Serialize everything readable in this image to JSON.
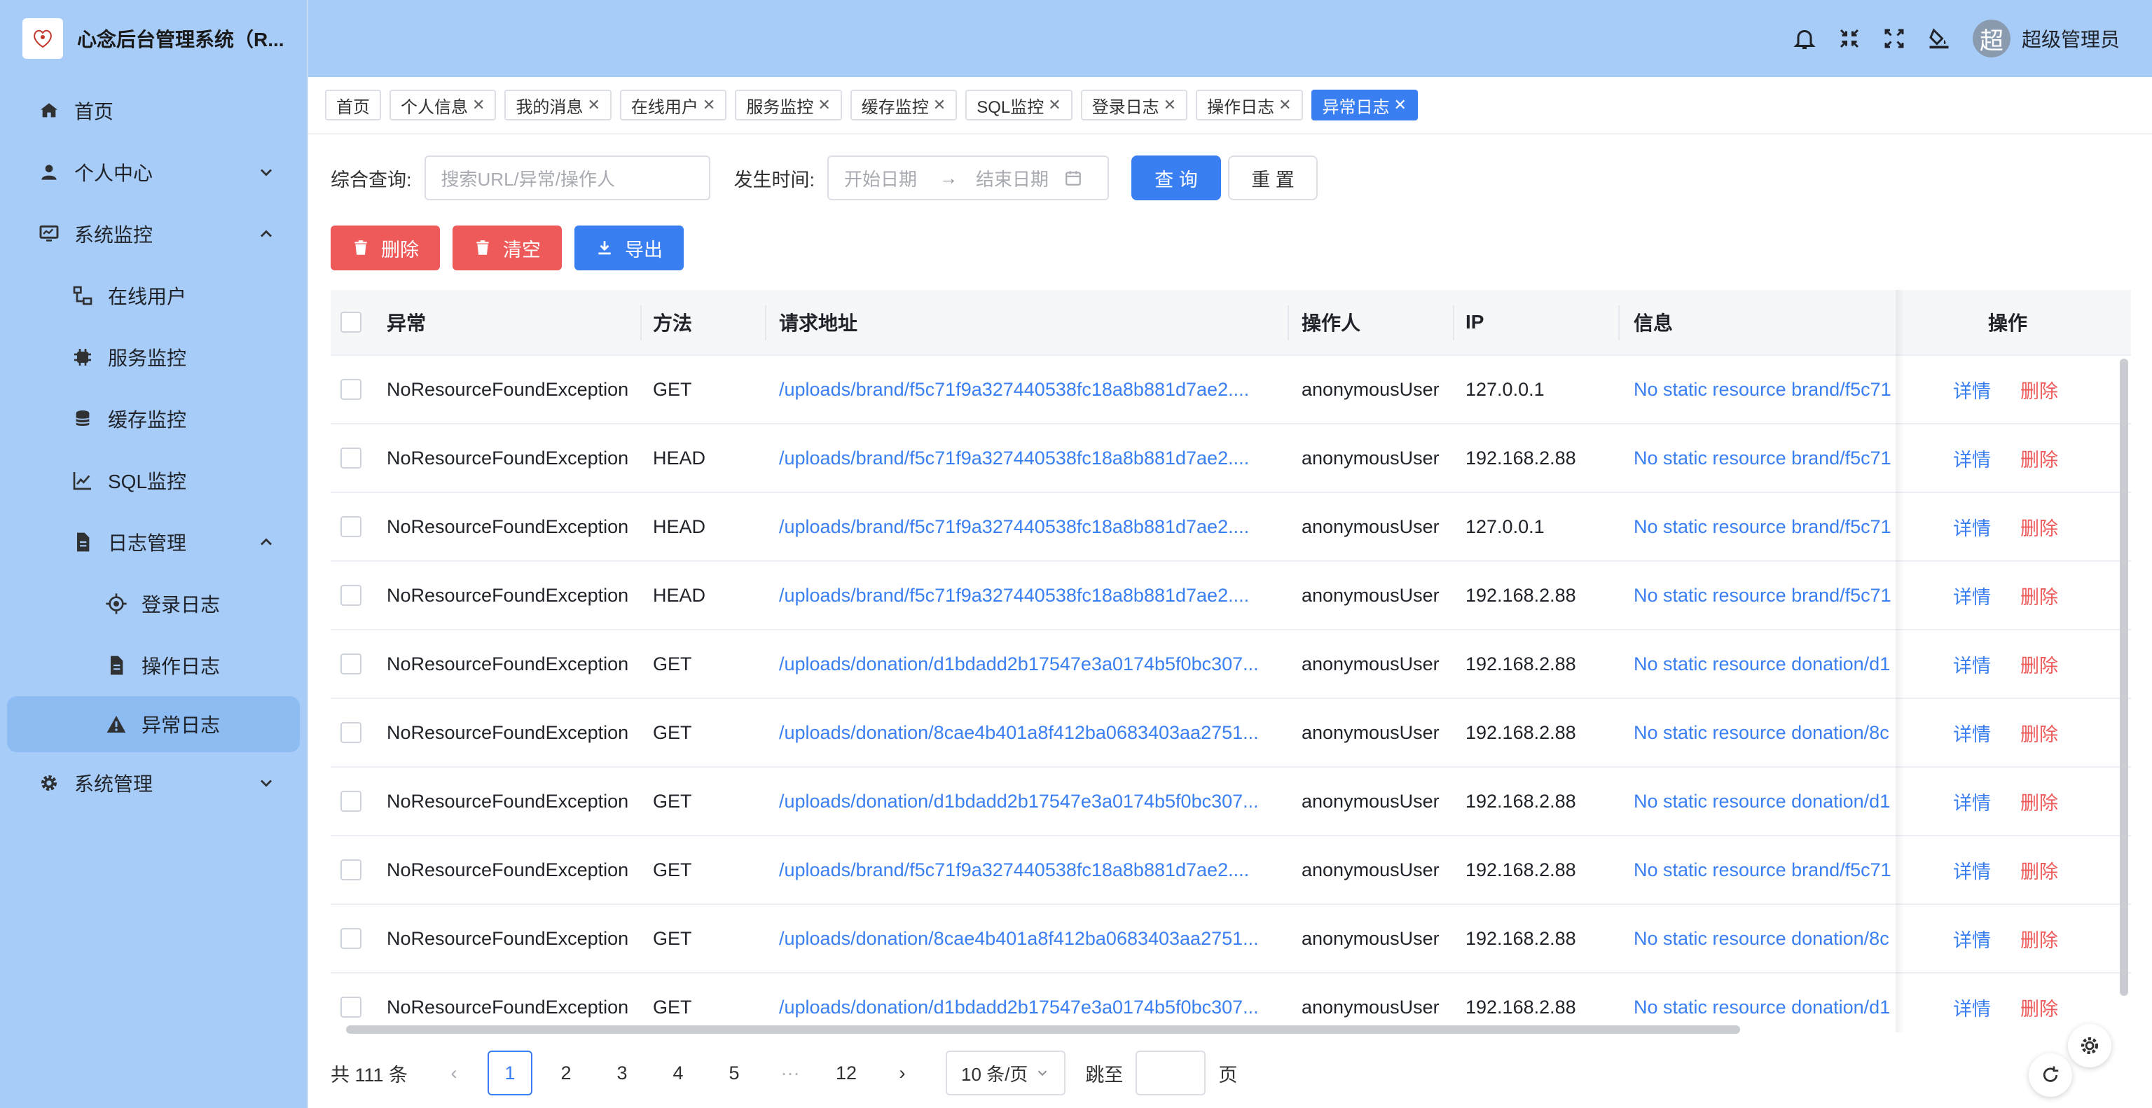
{
  "app": {
    "title": "心念后台管理系统（R..."
  },
  "sidebar": {
    "items": [
      {
        "label": "首页",
        "icon": "home-icon"
      },
      {
        "label": "个人中心",
        "icon": "user-icon"
      },
      {
        "label": "系统监控",
        "icon": "monitor-icon"
      },
      {
        "label": "在线用户",
        "icon": "org-icon"
      },
      {
        "label": "服务监控",
        "icon": "chip-icon"
      },
      {
        "label": "缓存监控",
        "icon": "database-icon"
      },
      {
        "label": "SQL监控",
        "icon": "line-chart-icon"
      },
      {
        "label": "日志管理",
        "icon": "file-icon"
      },
      {
        "label": "登录日志",
        "icon": "target-icon"
      },
      {
        "label": "操作日志",
        "icon": "file-icon"
      },
      {
        "label": "异常日志",
        "icon": "warning-icon"
      },
      {
        "label": "系统管理",
        "icon": "gear-icon"
      }
    ]
  },
  "header": {
    "avatar_text": "超",
    "username": "超级管理员"
  },
  "tabs": [
    "首页",
    "个人信息",
    "我的消息",
    "在线用户",
    "服务监控",
    "缓存监控",
    "SQL监控",
    "登录日志",
    "操作日志",
    "异常日志"
  ],
  "search": {
    "query_label": "综合查询:",
    "query_placeholder": "搜索URL/异常/操作人",
    "time_label": "发生时间:",
    "start_placeholder": "开始日期",
    "arrow": "→",
    "end_placeholder": "结束日期",
    "search_btn": "查 询",
    "reset_btn": "重 置"
  },
  "toolbar": {
    "delete_label": "删除",
    "clear_label": "清空",
    "export_label": "导出"
  },
  "table": {
    "headers": {
      "exception": "异常",
      "method": "方法",
      "url": "请求地址",
      "operator": "操作人",
      "ip": "IP",
      "info": "信息",
      "action": "操作"
    },
    "detail_label": "详情",
    "delete_label": "删除",
    "rows": [
      {
        "exception": "NoResourceFoundException",
        "method": "GET",
        "url": "/uploads/brand/f5c71f9a327440538fc18a8b881d7ae2....",
        "operator": "anonymousUser",
        "ip": "127.0.0.1",
        "info": "No static resource brand/f5c71"
      },
      {
        "exception": "NoResourceFoundException",
        "method": "HEAD",
        "url": "/uploads/brand/f5c71f9a327440538fc18a8b881d7ae2....",
        "operator": "anonymousUser",
        "ip": "192.168.2.88",
        "info": "No static resource brand/f5c71"
      },
      {
        "exception": "NoResourceFoundException",
        "method": "HEAD",
        "url": "/uploads/brand/f5c71f9a327440538fc18a8b881d7ae2....",
        "operator": "anonymousUser",
        "ip": "127.0.0.1",
        "info": "No static resource brand/f5c71"
      },
      {
        "exception": "NoResourceFoundException",
        "method": "HEAD",
        "url": "/uploads/brand/f5c71f9a327440538fc18a8b881d7ae2....",
        "operator": "anonymousUser",
        "ip": "192.168.2.88",
        "info": "No static resource brand/f5c71"
      },
      {
        "exception": "NoResourceFoundException",
        "method": "GET",
        "url": "/uploads/donation/d1bdadd2b17547e3a0174b5f0bc307...",
        "operator": "anonymousUser",
        "ip": "192.168.2.88",
        "info": "No static resource donation/d1"
      },
      {
        "exception": "NoResourceFoundException",
        "method": "GET",
        "url": "/uploads/donation/8cae4b401a8f412ba0683403aa2751...",
        "operator": "anonymousUser",
        "ip": "192.168.2.88",
        "info": "No static resource donation/8c"
      },
      {
        "exception": "NoResourceFoundException",
        "method": "GET",
        "url": "/uploads/donation/d1bdadd2b17547e3a0174b5f0bc307...",
        "operator": "anonymousUser",
        "ip": "192.168.2.88",
        "info": "No static resource donation/d1"
      },
      {
        "exception": "NoResourceFoundException",
        "method": "GET",
        "url": "/uploads/brand/f5c71f9a327440538fc18a8b881d7ae2....",
        "operator": "anonymousUser",
        "ip": "192.168.2.88",
        "info": "No static resource brand/f5c71"
      },
      {
        "exception": "NoResourceFoundException",
        "method": "GET",
        "url": "/uploads/donation/8cae4b401a8f412ba0683403aa2751...",
        "operator": "anonymousUser",
        "ip": "192.168.2.88",
        "info": "No static resource donation/8c"
      },
      {
        "exception": "NoResourceFoundException",
        "method": "GET",
        "url": "/uploads/donation/d1bdadd2b17547e3a0174b5f0bc307...",
        "operator": "anonymousUser",
        "ip": "192.168.2.88",
        "info": "No static resource donation/d1"
      }
    ]
  },
  "pagination": {
    "total": "共 111 条",
    "pages": [
      "1",
      "2",
      "3",
      "4",
      "5",
      "···",
      "12"
    ],
    "current": "1",
    "page_size": "10 条/页",
    "jump_label": "跳至",
    "page_unit": "页"
  },
  "colors": {
    "primary": "#3a7ff1",
    "danger": "#ee5a5a",
    "sidebar_bg": "#a8ccf8"
  }
}
